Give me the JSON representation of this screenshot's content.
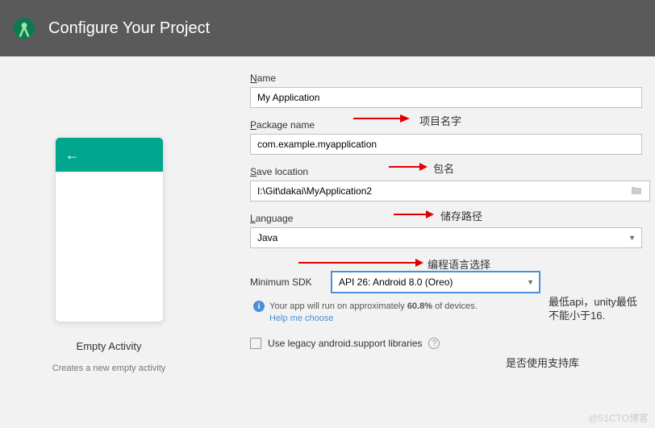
{
  "header": {
    "title": "Configure Your Project"
  },
  "preview": {
    "title": "Empty Activity",
    "subtitle": "Creates a new empty activity"
  },
  "form": {
    "name": {
      "label_prefix": "N",
      "label_rest": "ame",
      "value": "My Application"
    },
    "package": {
      "label_prefix": "P",
      "label_rest": "ackage name",
      "value": "com.example.myapplication"
    },
    "location": {
      "label_prefix": "S",
      "label_rest": "ave location",
      "value": "I:\\Git\\dakai\\MyApplication2"
    },
    "language": {
      "label_prefix": "L",
      "label_rest": "anguage",
      "value": "Java"
    },
    "minsdk": {
      "label": "Minimum SDK",
      "value": "API 26: Android 8.0 (Oreo)"
    },
    "info_pre": "Your app will run on approximately ",
    "info_pct": "60.8%",
    "info_post": " of devices.",
    "help": "Help me choose",
    "legacy_label": "Use legacy android.support libraries"
  },
  "annotations": {
    "name": "项目名字",
    "package": "包名",
    "location": "储存路径",
    "language": "编程语言选择",
    "minsdk": "最低api，unity最低不能小于16.",
    "legacy": "是否使用支持库"
  },
  "watermark": "@51CTO博客"
}
